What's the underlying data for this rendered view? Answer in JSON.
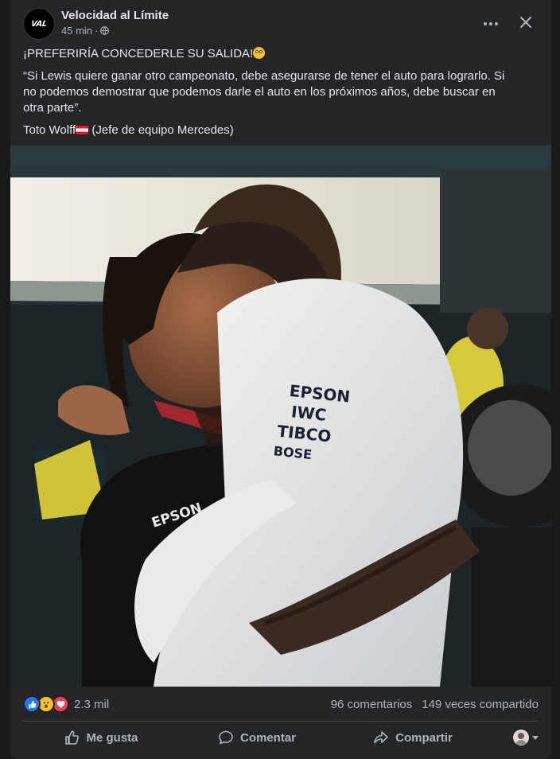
{
  "post": {
    "page_name": "Velocidad al Límite",
    "avatar_text": "VAL",
    "time": "45 min",
    "separator": "·",
    "privacy_icon": "globe-icon",
    "headline": "¡PREFERIRÍA CONCEDERLE SU SALIDA!",
    "headline_emoji": "flushed-face-emoji",
    "quote": "“Si Lewis quiere ganar otro campeonato, debe asegurarse de tener el auto para lograrlo. Si no podemos demostrar que podemos darle el auto en los próximos años, debe buscar en otra parte”.",
    "attribution_name": "Toto Wolff",
    "attribution_flag": "austria-flag",
    "attribution_role": "(Jefe de equipo Mercedes)"
  },
  "photo": {
    "sponsor_lines": [
      "EPSON",
      "IWC",
      "TIBCO",
      "BOSE"
    ],
    "sleeve_text": "EPSON"
  },
  "stats": {
    "reaction_icons": [
      "like-icon",
      "wow-icon",
      "love-icon"
    ],
    "reaction_count": "2.3 mil",
    "comments": "96 comentarios",
    "shares": "149 veces compartido"
  },
  "actions": {
    "like": "Me gusta",
    "comment": "Comentar",
    "share": "Compartir"
  },
  "colors": {
    "background": "#18191a",
    "card": "#242526",
    "text_primary": "#e4e6eb",
    "text_secondary": "#b0b3b8",
    "like_blue": "#2078f4",
    "love_red": "#f33e58",
    "wow_yellow": "#f7c12e"
  }
}
